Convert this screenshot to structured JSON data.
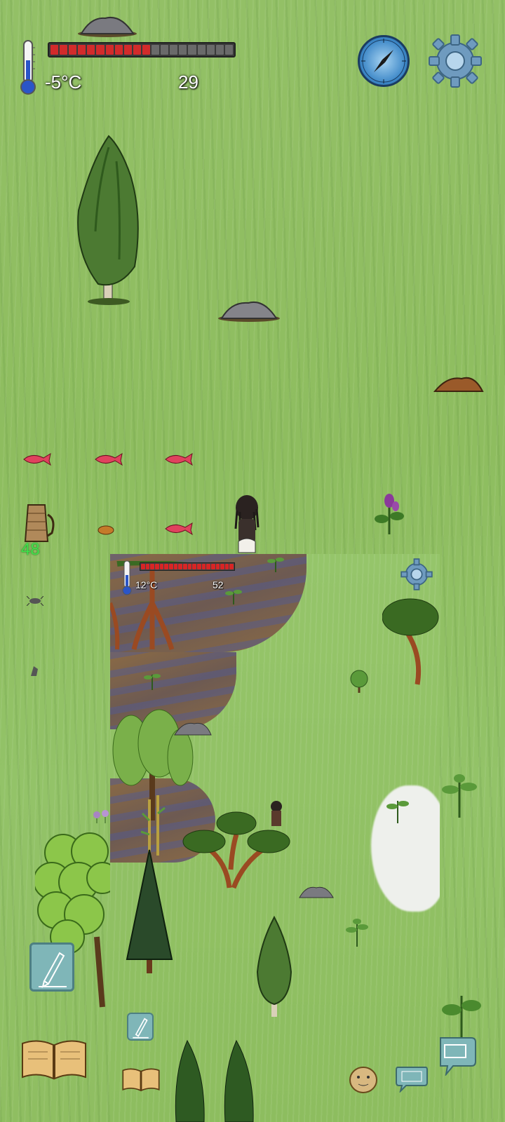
{
  "hud": {
    "temperature": "-5°C",
    "count": "29",
    "health_fraction": 0.55,
    "health_segments_total": 20,
    "health_segments_filled": 11
  },
  "inventory": {
    "bag_count": "48",
    "bag_count_color": "#3fe04a"
  },
  "inset": {
    "temperature": "12°C",
    "count": "52",
    "health_fraction": 1.0
  },
  "icons": {
    "compass": "compass-icon",
    "settings": "gear-icon",
    "journal": "book-icon",
    "write": "pencil-icon",
    "keyboard": "keyboard-icon",
    "chat": "chat-bubble-icon"
  },
  "colors": {
    "grass": "#8fbf62",
    "health_fill": "#d22b2b",
    "health_empty": "#6a6a6a"
  }
}
